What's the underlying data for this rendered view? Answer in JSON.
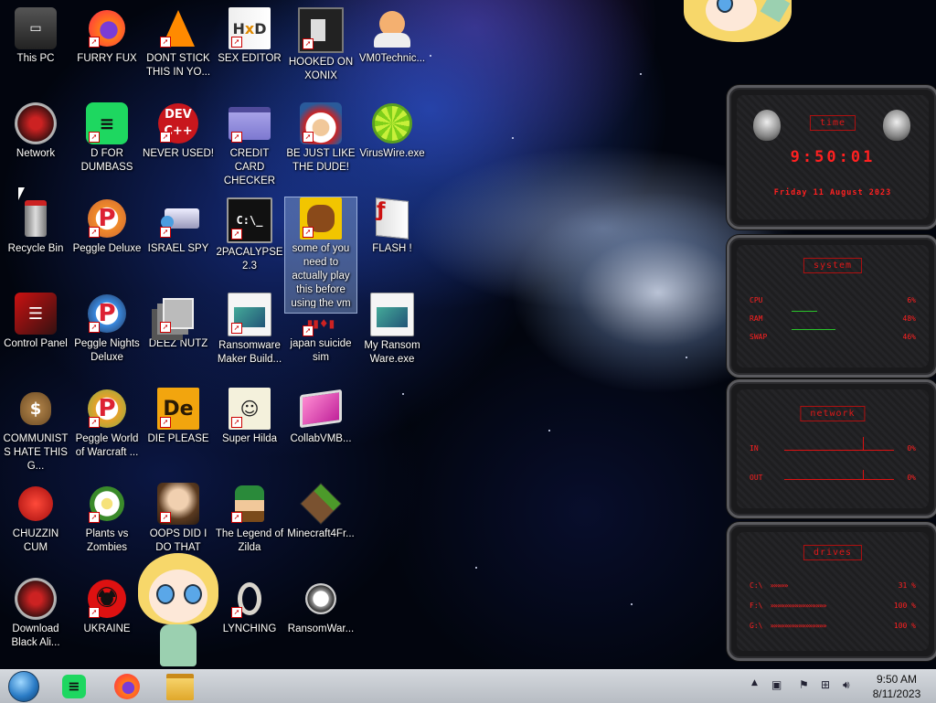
{
  "desktop": {
    "icons": [
      {
        "label": "This PC",
        "icon": "computer-icon"
      },
      {
        "label": "FURRY FUX",
        "icon": "firefox-icon"
      },
      {
        "label": "DONT STICK THIS IN YO...",
        "icon": "vlc-cone-icon"
      },
      {
        "label": "SEX EDITOR",
        "icon": "hxd-icon"
      },
      {
        "label": "HOOKED ON XONIX",
        "icon": "xonix-icon"
      },
      {
        "label": "VM0Technic...",
        "icon": "doctor-icon"
      },
      {
        "label": "Network",
        "icon": "network-icon"
      },
      {
        "label": "D FOR DUMBASS",
        "icon": "spotify-icon"
      },
      {
        "label": "NEVER USED!",
        "icon": "devcpp-icon"
      },
      {
        "label": "CREDIT CARD CHECKER",
        "icon": "credit-card-icon"
      },
      {
        "label": "BE JUST LIKE THE DUDE!",
        "icon": "gnome-icon"
      },
      {
        "label": "VirusWire.exe",
        "icon": "lime-icon"
      },
      {
        "label": "Recycle Bin",
        "icon": "recycle-bin-icon"
      },
      {
        "label": "Peggle Deluxe",
        "icon": "peggle-icon"
      },
      {
        "label": "ISRAEL SPY",
        "icon": "spy-icon"
      },
      {
        "label": "2PACALYPSE 2.3",
        "icon": "terminal-icon"
      },
      {
        "label": "some of you need to actually play this before using the vm",
        "icon": "dog-icon"
      },
      {
        "label": "FLASH !",
        "icon": "flash-icon"
      },
      {
        "label": "Control Panel",
        "icon": "control-panel-icon"
      },
      {
        "label": "Peggle Nights Deluxe",
        "icon": "peggle-nights-icon"
      },
      {
        "label": "DEEZ NUTZ",
        "icon": "stack-icon"
      },
      {
        "label": "Ransomware Maker Build...",
        "icon": "window-icon"
      },
      {
        "label": "japan suicide sim",
        "icon": "japan-sim-icon"
      },
      {
        "label": "My Ransom Ware.exe",
        "icon": "window-exe-icon"
      },
      {
        "label": "COMMUNISTS HATE THIS G...",
        "icon": "money-bag-icon"
      },
      {
        "label": "Peggle World of Warcraft ...",
        "icon": "peggle-wow-icon"
      },
      {
        "label": "DIE PLEASE",
        "icon": "de-icon"
      },
      {
        "label": "Super Hilda",
        "icon": "hilda-icon"
      },
      {
        "label": "CollabVMB...",
        "icon": "monitor-icon"
      },
      {
        "label": "CHUZZIN CUM",
        "icon": "chuzzle-icon"
      },
      {
        "label": "Plants vs Zombies",
        "icon": "pvz-icon"
      },
      {
        "label": "OOPS DID I DO THAT",
        "icon": "portrait-icon"
      },
      {
        "label": "The Legend of Zilda",
        "icon": "link-icon"
      },
      {
        "label": "Minecraft4Fr...",
        "icon": "grass-block-icon"
      },
      {
        "label": "Download Black Ali...",
        "icon": "alienware-icon"
      },
      {
        "label": "UKRAINE",
        "icon": "radiation-icon"
      },
      {
        "label": "LYNCHING",
        "icon": "noose-icon"
      },
      {
        "label": "RansomWar...",
        "icon": "skull-icon"
      }
    ]
  },
  "widget": {
    "time_title": "time",
    "time": "9:50:01",
    "date": "Friday 11 August 2023",
    "system_title": "system",
    "cpu_label": "CPU",
    "cpu_value": "6%",
    "ram_label": "RAM",
    "ram_value": "48%",
    "swap_label": "SWAP",
    "swap_value": "46%",
    "network_title": "network",
    "in_label": "IN",
    "in_value": "0%",
    "out_label": "OUT",
    "out_value": "0%",
    "drives_title": "drives",
    "drives": [
      {
        "label": "C:\\",
        "value": "31 %"
      },
      {
        "label": "F:\\",
        "value": "100 %"
      },
      {
        "label": "G:\\",
        "value": "100 %"
      }
    ]
  },
  "taskbar": {
    "pinned": [
      "start-orb-icon",
      "spotify-icon",
      "firefox-icon",
      "file-explorer-icon"
    ],
    "tray": {
      "time": "9:50 AM",
      "date": "8/11/2023"
    }
  },
  "colors": {
    "taskbar": "#c4c8ce",
    "widget_red": "#ff2020",
    "selection": "#aac8f0"
  }
}
